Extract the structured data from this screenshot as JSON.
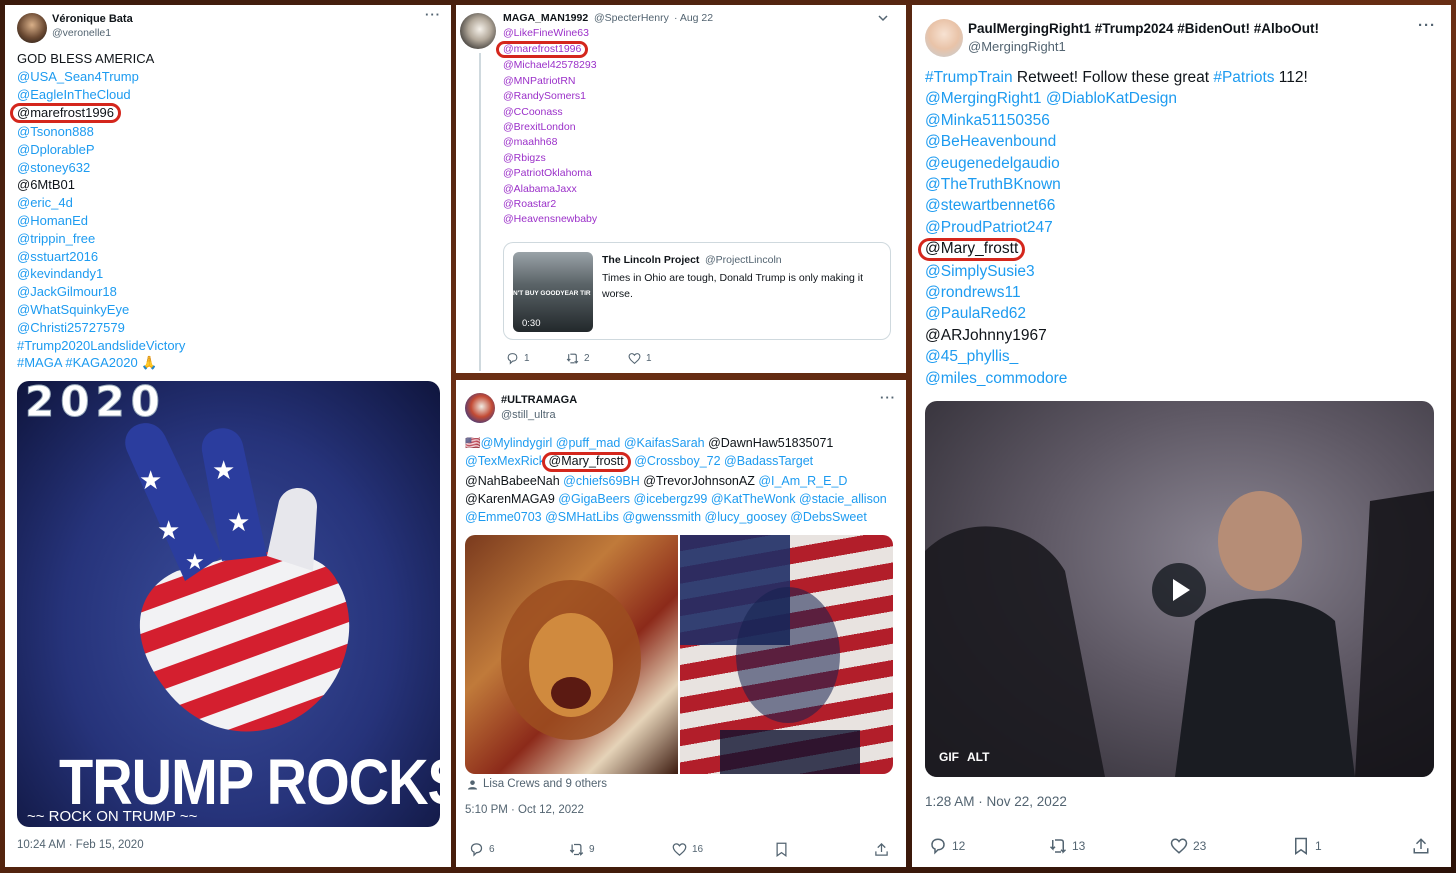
{
  "tweet1": {
    "name": "Véronique Bata",
    "handle": "@veronelle1",
    "lines": [
      {
        "text": "GOD BLESS AMERICA",
        "style": "dark"
      },
      {
        "text": "@USA_Sean4Trump",
        "style": "mention"
      },
      {
        "text": "@EagleInTheCloud",
        "style": "mention"
      },
      {
        "text": "@marefrost1996",
        "style": "dark circled"
      },
      {
        "text": "@Tsonon888",
        "style": "mention"
      },
      {
        "text": "@DplorableP",
        "style": "mention"
      },
      {
        "text": "@stoney632",
        "style": "mention"
      },
      {
        "text": "@6MtB01",
        "style": "dark"
      },
      {
        "text": "@eric_4d",
        "style": "mention"
      },
      {
        "text": "@HomanEd",
        "style": "mention"
      },
      {
        "text": "@trippin_free",
        "style": "mention"
      },
      {
        "text": "@sstuart2016",
        "style": "mention"
      },
      {
        "text": "@kevindandy1",
        "style": "mention"
      },
      {
        "text": "@JackGilmour18",
        "style": "mention"
      },
      {
        "text": "@WhatSquinkyEye",
        "style": "mention"
      },
      {
        "text": "@Christi25727579",
        "style": "mention"
      },
      {
        "text": "#Trump2020LandslideVictory",
        "style": "mention"
      },
      {
        "text": "#MAGA #KAGA2020 🙏",
        "style": "mention"
      }
    ],
    "image_top_text": "2020",
    "image_bottom_text": "TRUMP ROCKS",
    "image_caption": "~~ ROCK ON TRUMP ~~",
    "timestamp": "10:24 AM · Feb 15, 2020"
  },
  "tweet2": {
    "name": "MAGA_MAN1992",
    "handle": "@SpecterHenry",
    "date": "· Aug 22",
    "lines": [
      {
        "text": "@LikeFineWine63",
        "style": "purple"
      },
      {
        "text": "@marefrost1996",
        "style": "purple circled"
      },
      {
        "text": "@Michael42578293",
        "style": "purple"
      },
      {
        "text": "@MNPatriotRN",
        "style": "purple"
      },
      {
        "text": "@RandySomers1",
        "style": "purple"
      },
      {
        "text": "@CCoonass",
        "style": "purple"
      },
      {
        "text": "@BrexitLondon",
        "style": "purple"
      },
      {
        "text": "@maahh68",
        "style": "purple"
      },
      {
        "text": "@Rbigzs",
        "style": "purple"
      },
      {
        "text": "@PatriotOklahoma",
        "style": "purple"
      },
      {
        "text": "@AlabamaJaxx",
        "style": "purple"
      },
      {
        "text": "@Roastar2",
        "style": "purple"
      },
      {
        "text": "@Heavensnewbaby",
        "style": "purple"
      }
    ],
    "quote": {
      "name": "The Lincoln Project",
      "handle": "@ProjectLincoln",
      "text": "Times in Ohio are tough, Donald Trump is only making it worse.",
      "video_duration": "0:30",
      "thumb_text": "N'T BUY GOODYEAR TIR"
    },
    "replies": "1",
    "retweets": "2",
    "likes": "1"
  },
  "tweet3": {
    "name": "#ULTRAMAGA",
    "handle": "@still_ultra",
    "lines": [
      [
        {
          "text": "🇺🇸@Mylindygirl @puff_mad @KaifasSarah ",
          "style": "mention"
        },
        {
          "text": "@DawnHaw51835071",
          "style": "dark"
        }
      ],
      [
        {
          "text": "@TexMexRick ",
          "style": "mention"
        },
        {
          "text": "@Mary_frostt",
          "style": "dark circled"
        },
        {
          "text": " @Crossboy_72 @BadassTarget",
          "style": "mention"
        }
      ],
      [
        {
          "text": "@NahBabeeNah ",
          "style": "dark"
        },
        {
          "text": "@chiefs69BH ",
          "style": "mention"
        },
        {
          "text": "@TrevorJohnsonAZ ",
          "style": "dark"
        },
        {
          "text": "@I_Am_R_E_D",
          "style": "mention"
        }
      ],
      [
        {
          "text": "@KarenMAGA9 ",
          "style": "dark"
        },
        {
          "text": "@GigaBeers @icebergz99 @KatTheWonk @stacie_allison",
          "style": "mention"
        }
      ],
      [
        {
          "text": "@Emme0703 @SMHatLibs @gwenssmith @lucy_goosey @DebsSweet",
          "style": "mention"
        }
      ]
    ],
    "liked_by": "Lisa Crews and 9 others",
    "timestamp": "5:10 PM · Oct 12, 2022",
    "replies": "6",
    "retweets": "9",
    "likes": "16"
  },
  "tweet4": {
    "name": "PaulMergingRight1 #Trump2024 #BidenOut! #AlboOut!",
    "handle": "@MergingRight1",
    "lines": [
      [
        {
          "text": "#TrumpTrain",
          "style": "mention"
        },
        {
          "text": " Retweet! Follow these great ",
          "style": "dark"
        },
        {
          "text": "#Patriots",
          "style": "mention"
        },
        {
          "text": " 112!",
          "style": "dark"
        }
      ],
      [
        {
          "text": "@MergingRight1 @DiabloKatDesign",
          "style": "mention"
        }
      ],
      [
        {
          "text": "@Minka51150356",
          "style": "mention"
        }
      ],
      [
        {
          "text": "@BeHeavenbound",
          "style": "mention"
        }
      ],
      [
        {
          "text": "@eugenedelgaudio",
          "style": "mention"
        }
      ],
      [
        {
          "text": "@TheTruthBKnown",
          "style": "mention"
        }
      ],
      [
        {
          "text": "@stewartbennet66",
          "style": "mention"
        }
      ],
      [
        {
          "text": "@ProudPatriot247",
          "style": "mention"
        }
      ],
      [
        {
          "text": "@Mary_frostt",
          "style": "dark circled"
        }
      ],
      [
        {
          "text": "@SimplySusie3",
          "style": "mention"
        }
      ],
      [
        {
          "text": "@rondrews11",
          "style": "mention"
        }
      ],
      [
        {
          "text": "@PaulaRed62",
          "style": "mention"
        }
      ],
      [
        {
          "text": "@ARJohnny1967",
          "style": "dark"
        }
      ],
      [
        {
          "text": "@45_phyllis_",
          "style": "mention"
        }
      ],
      [
        {
          "text": "@miles_commodore",
          "style": "mention"
        }
      ]
    ],
    "gif_badge": "GIF",
    "alt_badge": "ALT",
    "timestamp": "1:28 AM · Nov 22, 2022",
    "replies": "12",
    "retweets": "13",
    "likes": "23",
    "bookmarks": "1"
  },
  "colors": {
    "mention": "#1d9bf0",
    "circle": "#d4261c",
    "purple": "#9b30c9",
    "muted": "#536471"
  },
  "icons": [
    "reply-icon",
    "retweet-icon",
    "like-icon",
    "bookmark-icon",
    "share-icon",
    "more-icon",
    "play-icon",
    "chevron-down-icon",
    "person-icon"
  ]
}
